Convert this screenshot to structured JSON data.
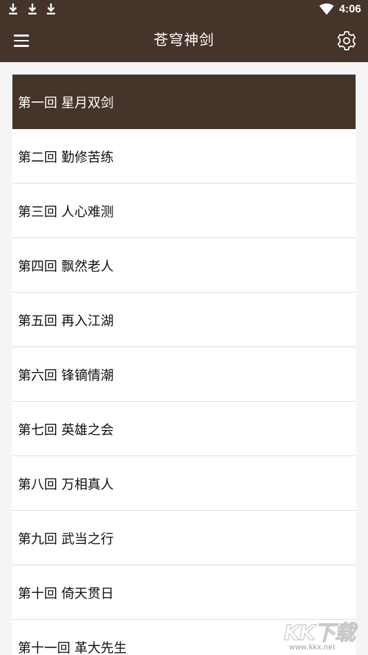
{
  "status_bar": {
    "time": "4:06",
    "notification_icons": [
      "download-icon",
      "download-icon",
      "download-icon"
    ],
    "wifi_icon": "wifi-icon"
  },
  "toolbar": {
    "title": "苍穹神剑",
    "menu_icon": "hamburger-menu-icon",
    "settings_icon": "gear-icon"
  },
  "chapters": {
    "items": [
      {
        "label": "第一回 星月双剑",
        "selected": true
      },
      {
        "label": "第二回 勤修苦练",
        "selected": false
      },
      {
        "label": "第三回 人心难测",
        "selected": false
      },
      {
        "label": "第四回 飘然老人",
        "selected": false
      },
      {
        "label": "第五回 再入江湖",
        "selected": false
      },
      {
        "label": "第六回 锋镝情潮",
        "selected": false
      },
      {
        "label": "第七回 英雄之会",
        "selected": false
      },
      {
        "label": "第八回 万相真人",
        "selected": false
      },
      {
        "label": "第九回 武当之行",
        "selected": false
      },
      {
        "label": "第十回 倚天贯日",
        "selected": false
      },
      {
        "label": "第十一回 革大先生",
        "selected": false
      }
    ]
  },
  "watermark": {
    "logo": "KK下载",
    "url": "www.kkx.net"
  },
  "colors": {
    "primary": "#44342a",
    "background": "#f5f5f5",
    "item_background": "#ffffff",
    "divider": "#dddddd"
  }
}
